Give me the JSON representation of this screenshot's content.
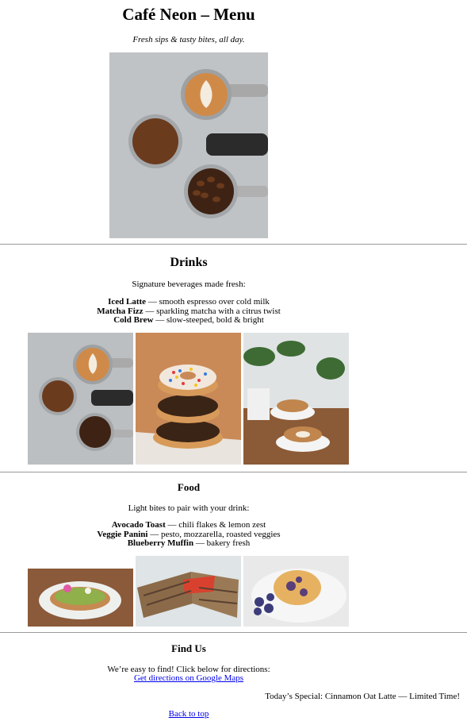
{
  "page": {
    "title": "Café Neon – Menu",
    "tagline": "Fresh sips & tasty bites, all day."
  },
  "drinks": {
    "heading": "Drinks",
    "intro": "Signature beverages made fresh:",
    "items": [
      {
        "name": "Iced Latte",
        "desc": " — smooth espresso over cold milk"
      },
      {
        "name": "Matcha Fizz",
        "desc": " — sparkling matcha with a citrus twist"
      },
      {
        "name": "Cold Brew",
        "desc": " — slow-steeped, bold & bright"
      }
    ]
  },
  "food": {
    "heading": "Food",
    "intro": "Light bites to pair with your drink:",
    "items": [
      {
        "name": "Avocado Toast",
        "desc": " — chili flakes & lemon zest"
      },
      {
        "name": "Veggie Panini",
        "desc": " — pesto, mozzarella, roasted veggies"
      },
      {
        "name": "Blueberry Muffin",
        "desc": " — bakery fresh"
      }
    ]
  },
  "find_us": {
    "heading": "Find Us",
    "intro": "We’re easy to find! Click below for directions:",
    "link_label": "Get directions on Google Maps"
  },
  "special": "Today’s Special: Cinnamon Oat Latte — Limited Time!",
  "back_to_top": "Back to top"
}
